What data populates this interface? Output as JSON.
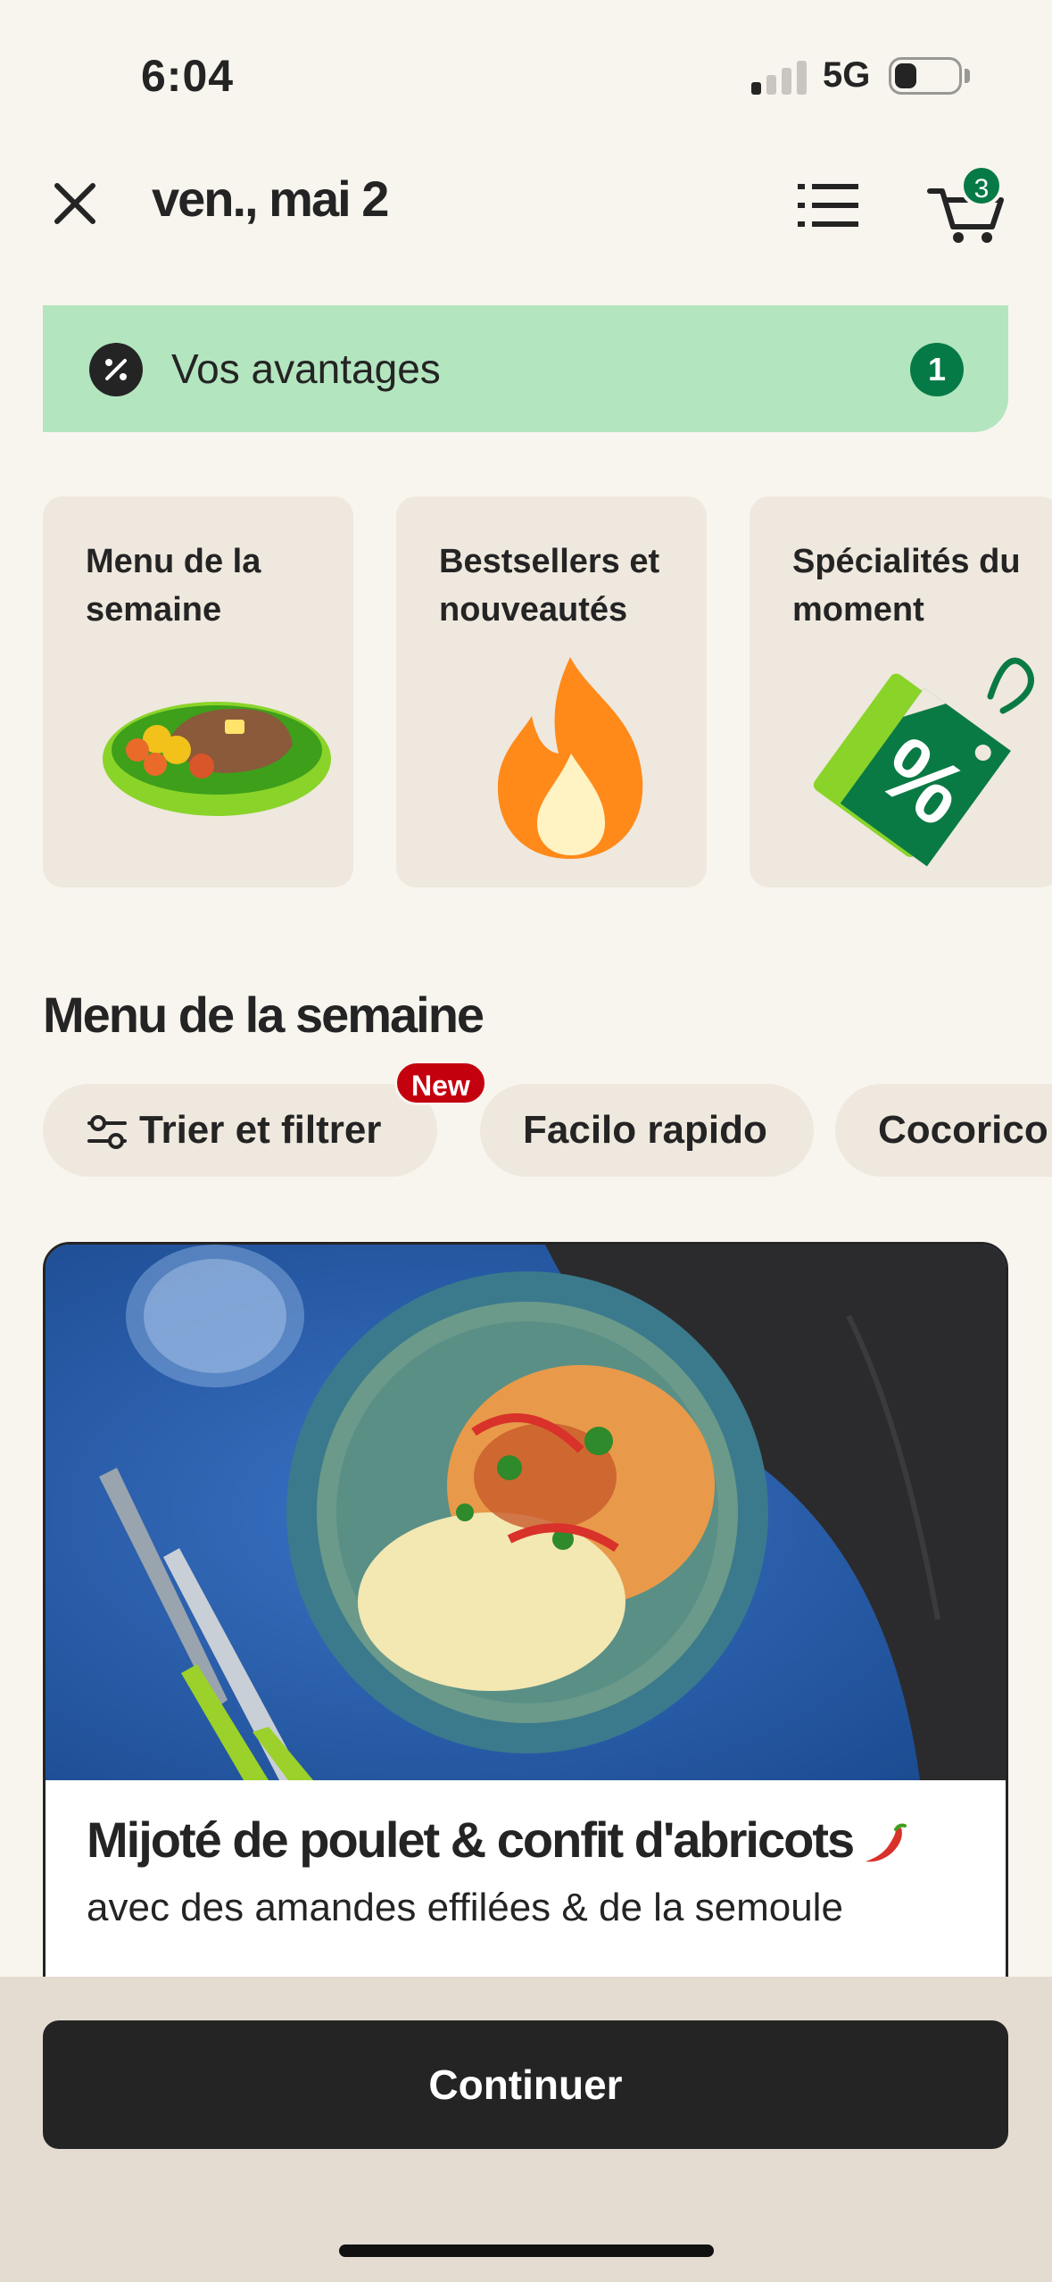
{
  "status_bar": {
    "time": "6:04",
    "network": "5G"
  },
  "header": {
    "date_title": "ven., mai 2",
    "cart_count": "3"
  },
  "promo": {
    "label": "Vos avantages",
    "count": "1"
  },
  "categories": [
    {
      "label": "Menu de la semaine",
      "icon": "meal-plate-icon"
    },
    {
      "label": "Bestsellers et nouveautés",
      "icon": "fire-icon"
    },
    {
      "label": "Spécialités du moment",
      "icon": "discount-tag-icon"
    }
  ],
  "section_title": "Menu de la semaine",
  "chips": [
    {
      "label": "Trier et filtrer",
      "badge": "New",
      "icon": "filter-sliders-icon"
    },
    {
      "label": "Facilo rapido"
    },
    {
      "label": "Cocorico"
    }
  ],
  "recipe": {
    "title": "Mijoté de poulet & confit d'abricots",
    "subtitle": "avec des amandes effilées & de la semoule",
    "spicy_icon": "chili-icon"
  },
  "continue_label": "Continuer",
  "colors": {
    "accent_green": "#067a46",
    "promo_bg": "#b3e5bf",
    "new_badge": "#c4000e",
    "dark": "#242424"
  }
}
